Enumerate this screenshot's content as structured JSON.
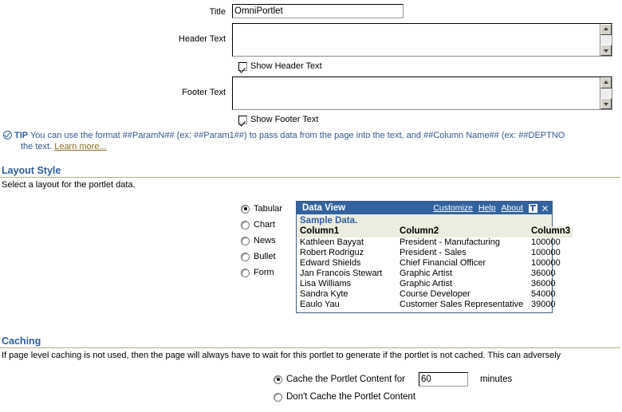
{
  "form": {
    "title": {
      "label": "Title",
      "value": "OmniPortlet",
      "placeholder": ""
    },
    "header_text": {
      "label": "Header Text",
      "value": "",
      "placeholder": ""
    },
    "show_header_text": {
      "label": "Show Header Text",
      "checked": true
    },
    "footer_text": {
      "label": "Footer Text",
      "value": "",
      "placeholder": ""
    },
    "show_footer_text": {
      "label": "Show Footer Text",
      "checked": true
    }
  },
  "tip": {
    "icon": "check-circle-icon",
    "word": "TIP",
    "line1": "You can use the format ##ParamN## (ex: ##Param1##) to pass data from the page into the text, and ##Column Name## (ex: ##DEPTNO",
    "line2": "the text.",
    "link": "Learn more..."
  },
  "layout_style": {
    "heading": "Layout Style",
    "description": "Select a layout for the portlet data.",
    "options": [
      {
        "label": "Tabular",
        "selected": true
      },
      {
        "label": "Chart",
        "selected": false
      },
      {
        "label": "News",
        "selected": false
      },
      {
        "label": "Bullet",
        "selected": false
      },
      {
        "label": "Form",
        "selected": false
      }
    ]
  },
  "preview_portlet": {
    "title": "Data View",
    "links": [
      "Customize",
      "Help",
      "About"
    ],
    "icons": [
      "collapse-icon",
      "close-icon"
    ],
    "sample_label": "Sample Data.",
    "columns": [
      "Column1",
      "Column2",
      "Column3"
    ],
    "rows": [
      [
        "Kathleen Bayyat",
        "President - Manufacturing",
        "100000"
      ],
      [
        "Robert Rodriguz",
        "President - Sales",
        "100000"
      ],
      [
        "Edward Shields",
        "Chief Financial Officer",
        "100000"
      ],
      [
        "Jan Francois Stewart",
        "Graphic Artist",
        "36000"
      ],
      [
        "Lisa Williams",
        "Graphic Artist",
        "36000"
      ],
      [
        "Sandra Kyte",
        "Course Developer",
        "54000"
      ],
      [
        "Eaulo Yau",
        "Customer Sales Representative",
        "39000"
      ]
    ]
  },
  "caching": {
    "heading": "Caching",
    "description": "If page level caching is not used, then the page will always have to wait for this portlet to generate if the portlet is not cached. This can adversely",
    "option_cache": {
      "label": "Cache the Portlet Content for",
      "selected": true
    },
    "minutes_value": "60",
    "minutes_label": "minutes",
    "option_no_cache": {
      "label": "Don't Cache the Portlet Content",
      "selected": false
    }
  },
  "colors": {
    "heading_blue": "#2F5FA0",
    "rule_tan": "#B5AE7E",
    "portlet_header_blue": "#33639E",
    "table_header_cream": "#EDEDDF",
    "link_gold": "#8a6d1f"
  }
}
